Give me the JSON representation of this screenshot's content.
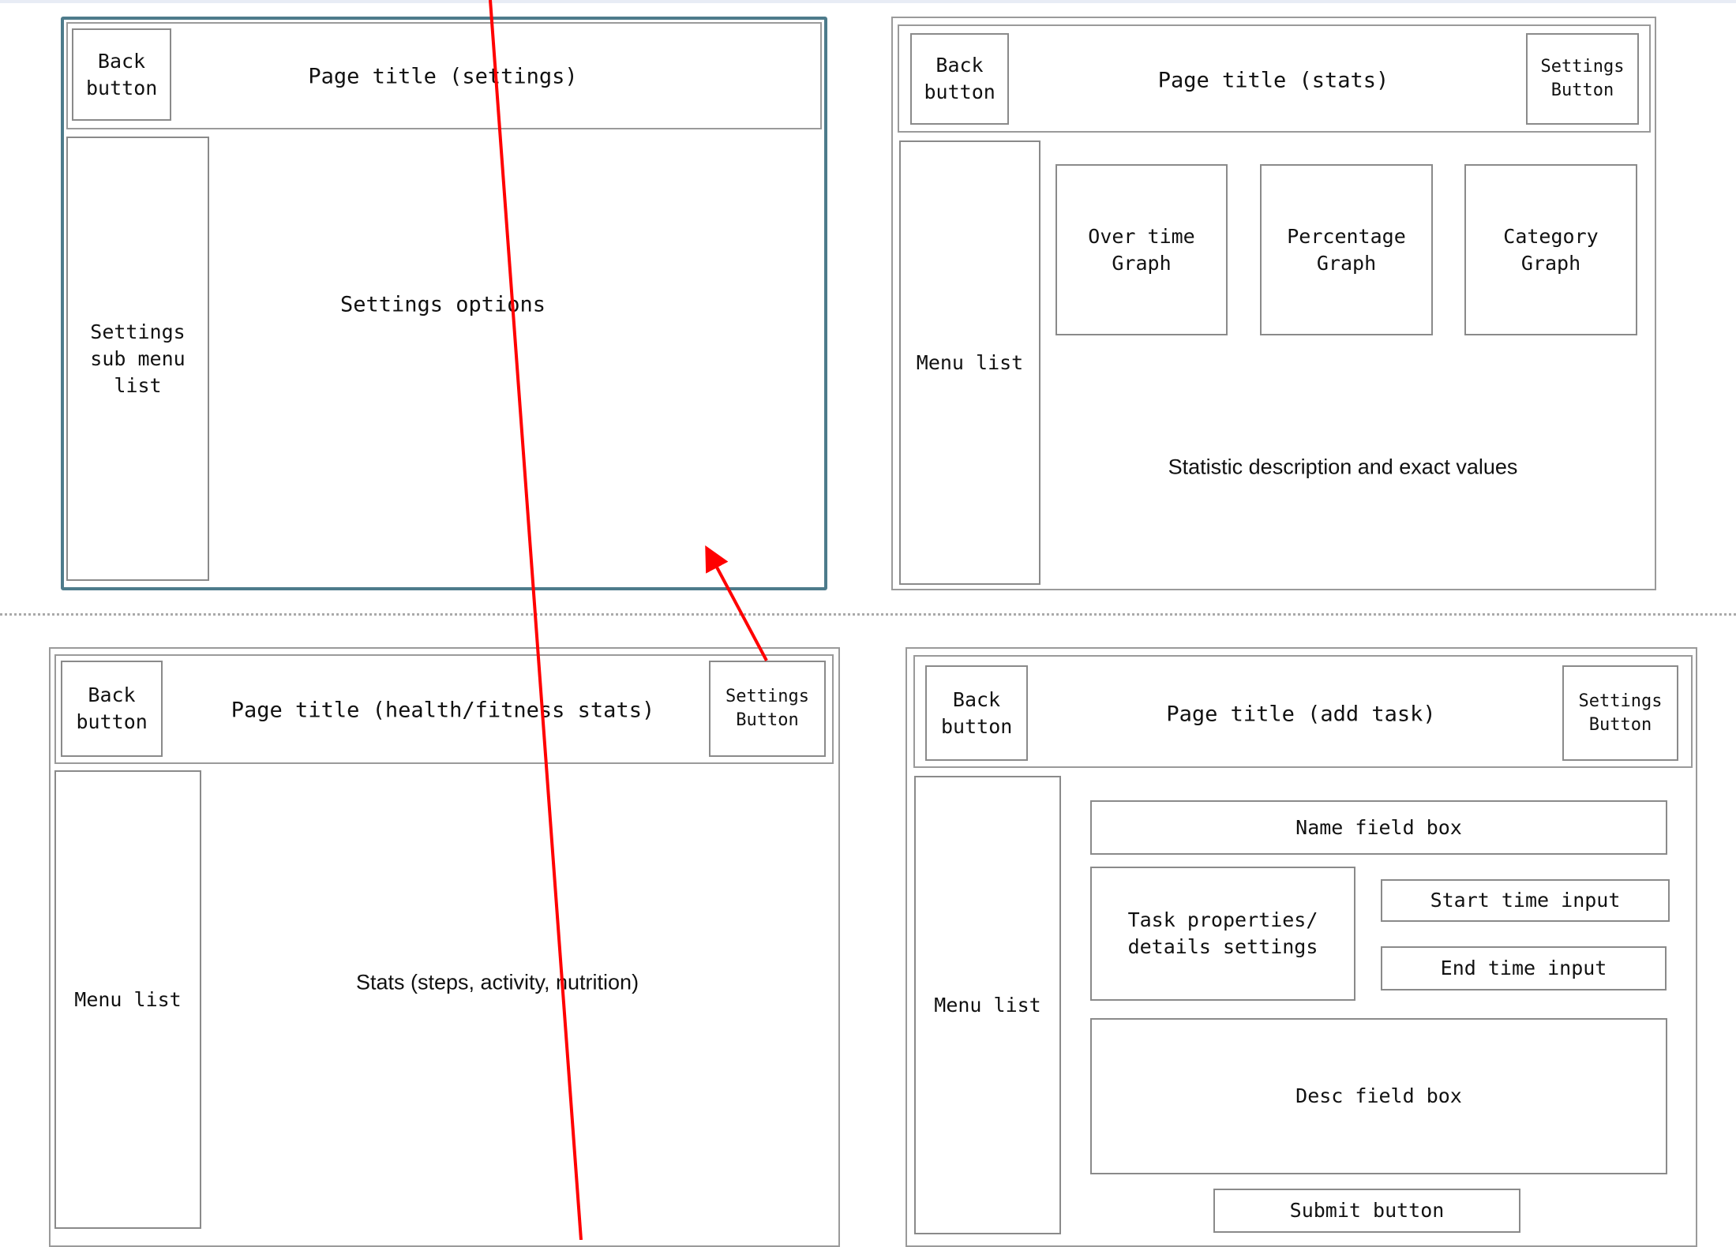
{
  "colors": {
    "annotation": "#ff0000",
    "selected_frame": "#4d7b8b",
    "box_border": "#8a8a8a"
  },
  "settings_screen": {
    "back_button": "Back button",
    "title": "Page title (settings)",
    "sidebar": "Settings sub menu list",
    "content": "Settings options"
  },
  "stats_screen": {
    "back_button": "Back button",
    "title": "Page title (stats)",
    "settings_button": "Settings Button",
    "menu": "Menu list",
    "graphs": [
      "Over time Graph",
      "Percentage Graph",
      "Category Graph"
    ],
    "description": "Statistic description and exact values"
  },
  "health_screen": {
    "back_button": "Back button",
    "title": "Page title (health/fitness stats)",
    "settings_button": "Settings Button",
    "menu": "Menu list",
    "content": "Stats (steps, activity, nutrition)"
  },
  "add_task_screen": {
    "back_button": "Back button",
    "title": "Page title (add task)",
    "settings_button": "Settings Button",
    "menu": "Menu list",
    "name_field": "Name field box",
    "task_properties": "Task properties/ details settings",
    "start_time": "Start time input",
    "end_time": "End time input",
    "desc_field": "Desc field box",
    "submit_button": "Submit button"
  }
}
